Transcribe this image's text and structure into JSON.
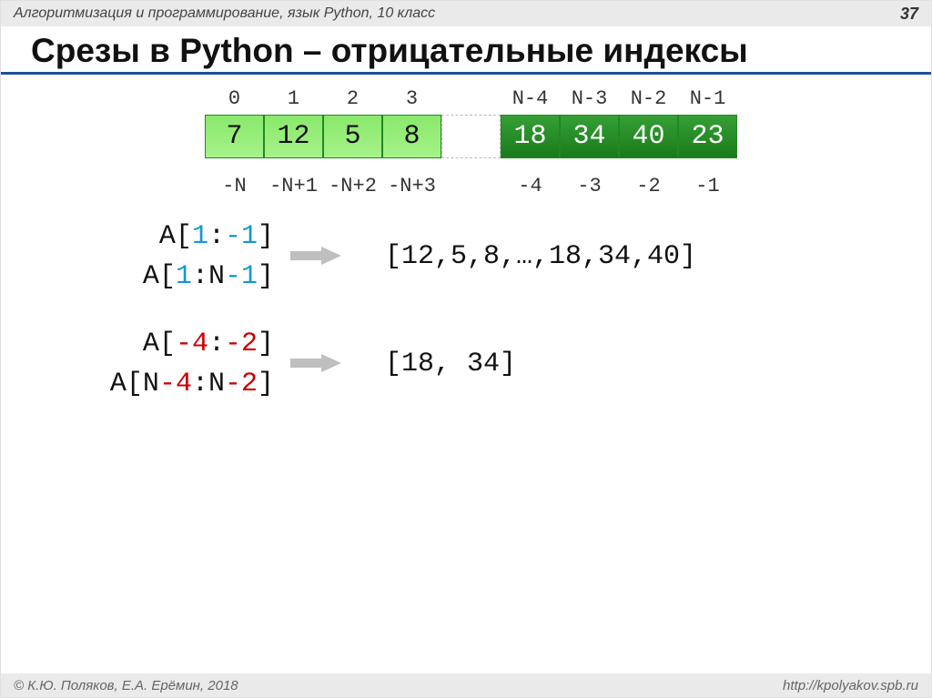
{
  "header": {
    "subject": "Алгоритмизация и программирование, язык Python, 10 класс",
    "page": "37"
  },
  "title": "Срезы в Python – отрицательные индексы",
  "array": {
    "top_idx": [
      "0",
      "1",
      "2",
      "3",
      "",
      "N-4",
      "N-3",
      "N-2",
      "N-1"
    ],
    "cells": [
      "7",
      "12",
      "5",
      "8",
      "",
      "18",
      "34",
      "40",
      "23"
    ],
    "bot_idx": [
      "-N",
      "-N+1",
      "-N+2",
      "-N+3",
      "",
      "-4",
      "-3",
      "-2",
      "-1"
    ]
  },
  "ex1": {
    "a_var": "A",
    "a_lb": "[",
    "a_i": "1",
    "a_sep": ":",
    "a_j": "-1",
    "a_rb": "]",
    "b_var": "A",
    "b_lb": "[",
    "b_i": "1",
    "b_sep": ":N",
    "b_j": "-1",
    "b_rb": "]",
    "result": "[12,5,8,…,18,34,40]"
  },
  "ex2": {
    "a_var": "A",
    "a_lb": "[",
    "a_i": "-4",
    "a_sep": ":",
    "a_j": "-2",
    "a_rb": "]",
    "b_var": "A",
    "b_lb": "[N",
    "b_i": "-4",
    "b_sep": ":N",
    "b_j": "-2",
    "b_rb": "]",
    "result": "[18, 34]"
  },
  "footer": {
    "copyright": "© К.Ю. Поляков, Е.А. Ерёмин, 2018",
    "url": "http://kpolyakov.spb.ru"
  }
}
